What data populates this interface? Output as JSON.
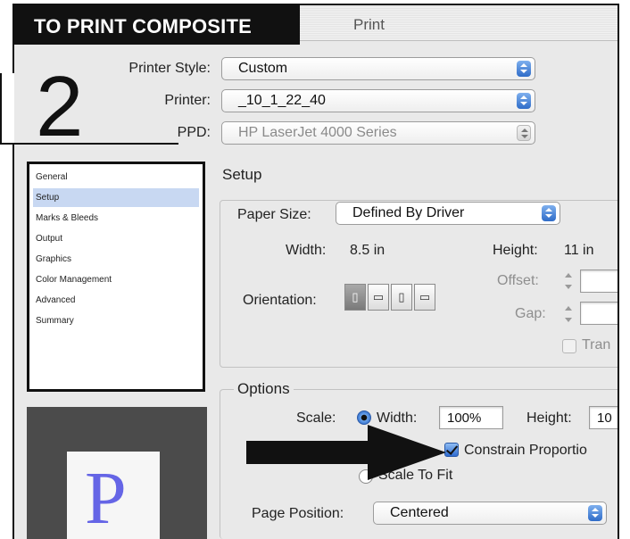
{
  "tag": {
    "label": "TO PRINT COMPOSITE"
  },
  "window": {
    "title": "Print"
  },
  "step_number": "2",
  "header": {
    "printer_style": {
      "label": "Printer Style:",
      "value": "Custom"
    },
    "printer": {
      "label": "Printer:",
      "value": "_10_1_22_40"
    },
    "ppd": {
      "label": "PPD:",
      "value": "HP LaserJet 4000 Series"
    }
  },
  "sidebar": {
    "items": [
      {
        "label": "General"
      },
      {
        "label": "Setup"
      },
      {
        "label": "Marks & Bleeds"
      },
      {
        "label": "Output"
      },
      {
        "label": "Graphics"
      },
      {
        "label": "Color Management"
      },
      {
        "label": "Advanced"
      },
      {
        "label": "Summary"
      }
    ],
    "selected": "Setup"
  },
  "preview": {
    "glyph": "P"
  },
  "setup": {
    "title": "Setup",
    "paper_size": {
      "label": "Paper Size:",
      "value": "Defined By Driver"
    },
    "width": {
      "label": "Width:",
      "value": "8.5 in"
    },
    "height": {
      "label": "Height:",
      "value": "11 in"
    },
    "offset": {
      "label": "Offset:"
    },
    "gap": {
      "label": "Gap:"
    },
    "transverse": {
      "label": "Tran"
    },
    "orientation": {
      "label": "Orientation:"
    }
  },
  "options": {
    "title": "Options",
    "scale": {
      "label": "Scale:"
    },
    "width": {
      "label": "Width:",
      "value": "100%"
    },
    "height": {
      "label": "Height:",
      "value": "10"
    },
    "constrain": {
      "label": "Constrain Proportio"
    },
    "scale_to_fit": {
      "label": "Scale To Fit"
    },
    "page_position": {
      "label": "Page Position:",
      "value": "Centered"
    }
  }
}
